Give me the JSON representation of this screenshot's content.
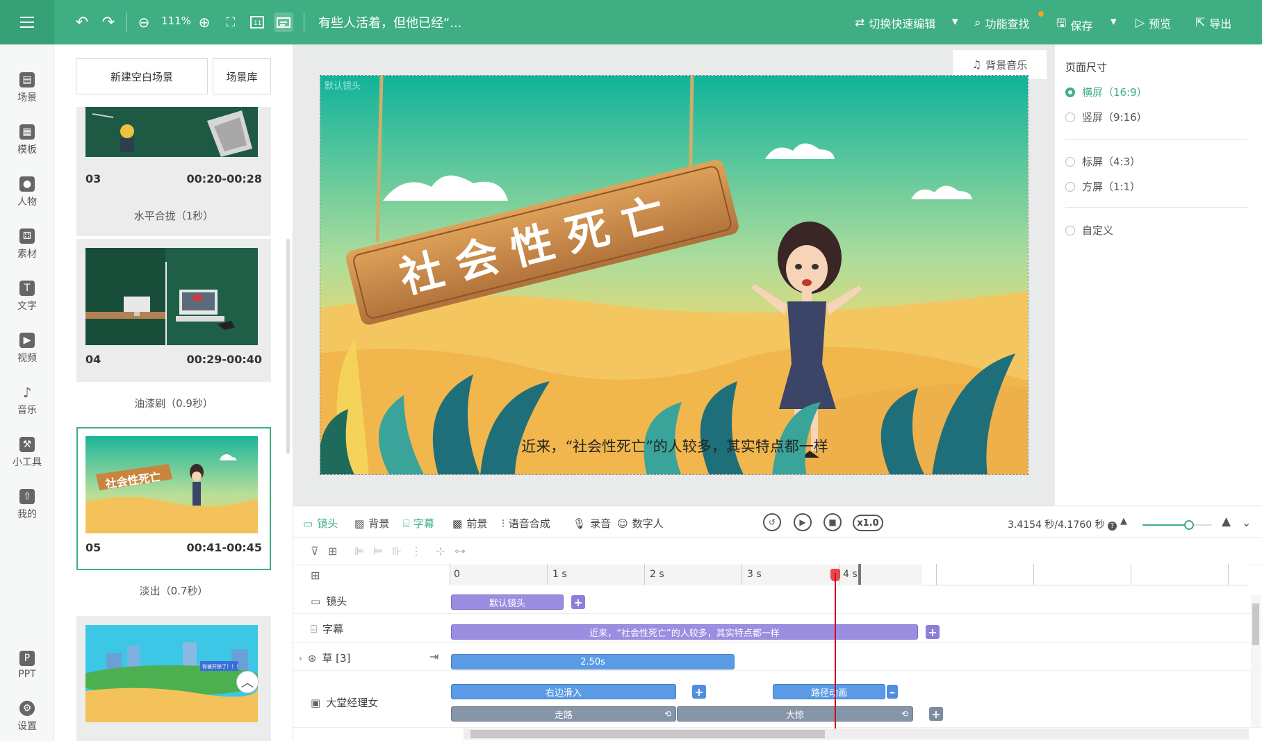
{
  "toolbar": {
    "zoom": "111%",
    "doc_title": "有些人活着，但他已经“...",
    "switch_edit": "切换快速编辑",
    "feature_search": "功能查找",
    "save": "保存",
    "preview": "预览",
    "export": "导出"
  },
  "nav": {
    "items": [
      {
        "label": "场景"
      },
      {
        "label": "模板"
      },
      {
        "label": "人物"
      },
      {
        "label": "素材"
      },
      {
        "label": "文字"
      },
      {
        "label": "视频"
      },
      {
        "label": "音乐"
      },
      {
        "label": "小工具"
      },
      {
        "label": "我的"
      },
      {
        "label": "PPT"
      },
      {
        "label": "设置"
      }
    ]
  },
  "scenes": {
    "new_blank": "新建空白场景",
    "library": "场景库",
    "items": [
      {
        "num": "03",
        "time": "00:20-00:28",
        "transition": "水平合拢（1秒）"
      },
      {
        "num": "04",
        "time": "00:29-00:40",
        "transition": "油漆刷（0.9秒）"
      },
      {
        "num": "05",
        "time": "00:41-00:45",
        "transition": "淡出（0.7秒）"
      }
    ],
    "thumb05_sign": "社会性死亡",
    "thumb06_caption": "你被开除了！！！"
  },
  "canvas": {
    "bgm_button": "背景音乐",
    "stage_label": "默认镜头",
    "sign_text": "社会性死亡",
    "subtitle": "近来，“社会性死亡”的人较多，其实特点都一样"
  },
  "page_size": {
    "title": "页面尺寸",
    "options": [
      {
        "label": "横屏（16:9）",
        "selected": true
      },
      {
        "label": "竖屏（9:16）",
        "selected": false
      },
      {
        "label": "标屏（4:3）",
        "selected": false
      },
      {
        "label": "方屏（1:1）",
        "selected": false
      },
      {
        "label": "自定义",
        "selected": false
      }
    ]
  },
  "timeline": {
    "tabs": [
      "镜头",
      "背景",
      "字幕",
      "前景",
      "语音合成",
      "录音",
      "数字人"
    ],
    "active_tab": "字幕",
    "speed": "x1.0",
    "time_position": "3.4154 秒/4.1760 秒",
    "ruler_labels": [
      "0",
      "1 s",
      "2 s",
      "3 s",
      "4 s"
    ],
    "tracks": [
      {
        "label": "镜头"
      },
      {
        "label": "字幕"
      },
      {
        "label": "草 [3]"
      },
      {
        "label": "大堂经理女"
      }
    ],
    "clips": {
      "camera": "默认镜头",
      "subtitle": "近来，“社会性死亡”的人较多，其实特点都一样",
      "grass": "2.50s",
      "enter": "右边滑入",
      "path": "路径动画",
      "walk": "走路",
      "shock": "大惊"
    }
  },
  "colors": {
    "accent": "#3fae83",
    "purple_clip": "#9b8ee0",
    "blue_clip": "#5b9be6",
    "gray_clip": "#8795a8",
    "playhead": "#d0021b"
  }
}
